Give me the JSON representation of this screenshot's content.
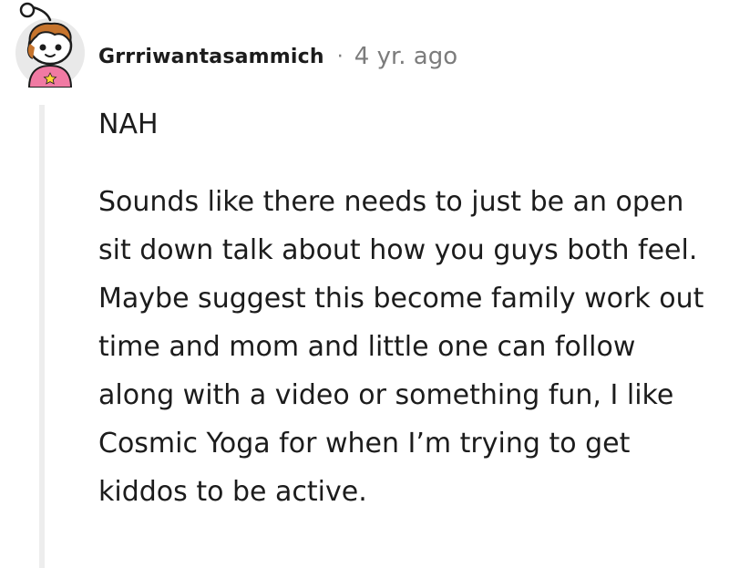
{
  "comment": {
    "username": "Grrriwantasammich",
    "separator": "·",
    "timestamp": "4 yr. ago",
    "avatar_icon": "snoo-avatar-icon",
    "paragraphs": [
      "NAH",
      "Sounds like there needs to just be an open sit down talk about how you guys both feel. Maybe suggest this become family work out time and mom and little one can follow along with a video or something fun, I like Cosmic Yoga for when I’m trying to get kiddos to be active."
    ]
  },
  "colors": {
    "text": "#1c1c1c",
    "meta": "#7c7c7c",
    "thread_line": "#ededed",
    "avatar_bg": "#e9e9e9",
    "avatar_shirt": "#f07aa3",
    "avatar_hair": "#c6742d"
  }
}
